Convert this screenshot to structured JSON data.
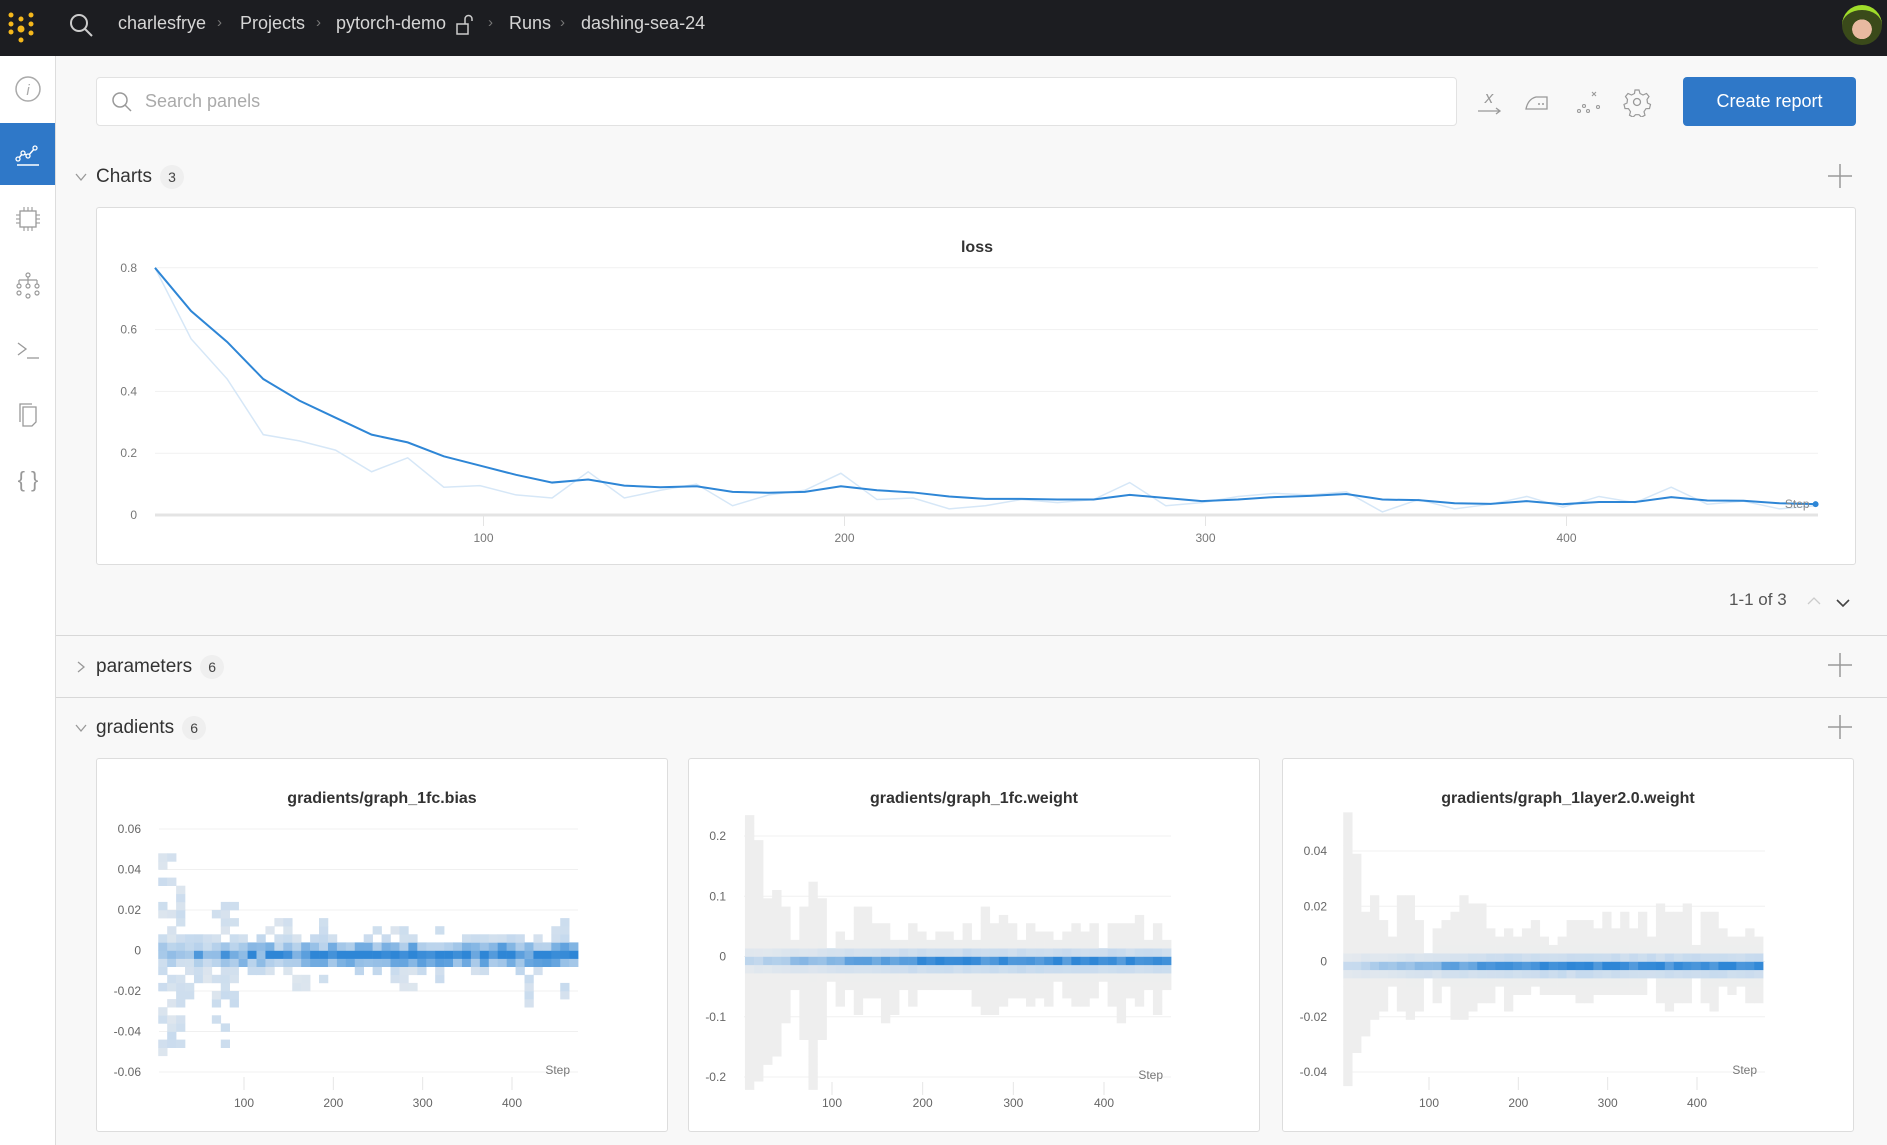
{
  "topbar": {
    "breadcrumbs": [
      "charlesfrye",
      "Projects",
      "pytorch-demo",
      "Runs",
      "dashing-sea-24"
    ],
    "icons": {
      "logo": "wandb-dots-logo",
      "search": "search-icon",
      "lock": "unlock-icon",
      "avatar": "user-avatar"
    }
  },
  "sidebar": {
    "items": [
      {
        "name": "overview",
        "icon": "info-icon",
        "active": false
      },
      {
        "name": "charts",
        "icon": "line-chart-icon",
        "active": true
      },
      {
        "name": "system",
        "icon": "chip-icon",
        "active": false
      },
      {
        "name": "model",
        "icon": "hierarchy-icon",
        "active": false
      },
      {
        "name": "logs",
        "icon": "terminal-icon",
        "active": false
      },
      {
        "name": "files",
        "icon": "files-icon",
        "active": false
      },
      {
        "name": "artifacts",
        "icon": "braces-icon",
        "active": false
      }
    ]
  },
  "toolbar": {
    "search_placeholder": "Search panels",
    "search_value": "",
    "create_report_label": "Create report",
    "icons": [
      "x-axis-icon",
      "smoothing-iron-icon",
      "outlier-icon",
      "settings-gear-icon"
    ]
  },
  "sections": {
    "charts": {
      "label": "Charts",
      "count": "3",
      "expanded": true,
      "pagination": "1-1 of 3"
    },
    "parameters": {
      "label": "parameters",
      "count": "6",
      "expanded": false
    },
    "gradients": {
      "label": "gradients",
      "count": "6",
      "expanded": true
    }
  },
  "colors": {
    "accent": "#2f78c8",
    "line": "#2e86d6",
    "line_raw": "#d6e7f7",
    "topbar": "#1c1d21"
  },
  "chart_data": [
    {
      "type": "line",
      "title": "loss",
      "xlabel": "Step",
      "xlim": [
        0,
        469
      ],
      "ylim": [
        0,
        0.8
      ],
      "xticks": [
        100,
        200,
        300,
        400
      ],
      "yticks": [
        0,
        0.2,
        0.4,
        0.6,
        0.8
      ],
      "ytick_labels": [
        "0",
        "0.2",
        "0.4",
        "0.6",
        "0.8"
      ],
      "grid": true,
      "x": [
        9,
        19,
        29,
        39,
        49,
        59,
        69,
        79,
        89,
        99,
        109,
        119,
        129,
        139,
        149,
        159,
        169,
        179,
        189,
        199,
        209,
        219,
        229,
        239,
        249,
        259,
        269,
        279,
        289,
        299,
        309,
        319,
        329,
        339,
        349,
        359,
        369,
        379,
        389,
        399,
        409,
        419,
        429,
        439,
        449,
        459,
        469
      ],
      "series": [
        {
          "style": "smoothed",
          "values": [
            0.8,
            0.66,
            0.56,
            0.44,
            0.37,
            0.315,
            0.26,
            0.235,
            0.19,
            0.16,
            0.13,
            0.105,
            0.115,
            0.095,
            0.09,
            0.093,
            0.075,
            0.072,
            0.075,
            0.093,
            0.08,
            0.073,
            0.06,
            0.052,
            0.052,
            0.05,
            0.05,
            0.065,
            0.055,
            0.045,
            0.05,
            0.058,
            0.062,
            0.068,
            0.05,
            0.048,
            0.038,
            0.036,
            0.045,
            0.035,
            0.042,
            0.042,
            0.058,
            0.047,
            0.046,
            0.038,
            0.035
          ]
        },
        {
          "style": "raw",
          "values": [
            0.8,
            0.57,
            0.44,
            0.26,
            0.24,
            0.21,
            0.14,
            0.185,
            0.09,
            0.095,
            0.065,
            0.055,
            0.14,
            0.055,
            0.08,
            0.1,
            0.03,
            0.065,
            0.08,
            0.135,
            0.05,
            0.055,
            0.02,
            0.03,
            0.05,
            0.04,
            0.05,
            0.105,
            0.03,
            0.04,
            0.06,
            0.07,
            0.065,
            0.075,
            0.01,
            0.05,
            0.02,
            0.035,
            0.06,
            0.025,
            0.06,
            0.04,
            0.09,
            0.035,
            0.045,
            0.02,
            0.03
          ]
        }
      ]
    },
    {
      "type": "heatmap",
      "title": "gradients/graph_1fc.bias",
      "xlabel": "Step",
      "xticks": [
        100,
        200,
        300,
        400
      ],
      "yticks": [
        0.06,
        0.04,
        0.02,
        0,
        -0.02,
        -0.04,
        -0.06
      ],
      "ytick_labels": [
        "0.06",
        "0.04",
        "0.02",
        "0",
        "-0.02",
        "-0.04",
        "-0.06"
      ],
      "x_start": 9,
      "x_step": 10,
      "bin": 0.004,
      "sparse": true,
      "ranges": [
        [
          0.063,
          -0.053
        ],
        [
          0.047,
          -0.048
        ],
        [
          0.03,
          -0.045
        ],
        [
          0.015,
          -0.03
        ],
        [
          0.01,
          -0.017
        ],
        [
          0.005,
          -0.015
        ],
        [
          0.02,
          -0.037
        ],
        [
          0.027,
          -0.065
        ],
        [
          0.023,
          -0.028
        ],
        [
          0.005,
          -0.005
        ],
        [
          0.008,
          -0.015
        ],
        [
          0.005,
          -0.01
        ],
        [
          0.02,
          -0.02
        ],
        [
          0.015,
          -0.012
        ],
        [
          0.015,
          -0.015
        ],
        [
          0.01,
          -0.028
        ],
        [
          0.007,
          -0.02
        ],
        [
          0.005,
          -0.012
        ],
        [
          0.015,
          -0.015
        ],
        [
          0.007,
          -0.005
        ],
        [
          0.005,
          -0.008
        ],
        [
          0.008,
          -0.008
        ],
        [
          0.01,
          -0.012
        ],
        [
          0.005,
          -0.008
        ],
        [
          0.01,
          -0.012
        ],
        [
          0.005,
          -0.005
        ],
        [
          0.01,
          -0.02
        ],
        [
          0.01,
          -0.02
        ],
        [
          0.008,
          -0.018
        ],
        [
          0.005,
          -0.01
        ],
        [
          0.008,
          -0.012
        ],
        [
          0.01,
          -0.015
        ],
        [
          0.005,
          -0.008
        ],
        [
          0.008,
          -0.012
        ],
        [
          0.005,
          -0.008
        ],
        [
          0.008,
          -0.012
        ],
        [
          0.008,
          -0.012
        ],
        [
          0.005,
          -0.01
        ],
        [
          0.01,
          -0.008
        ],
        [
          0.005,
          -0.005
        ],
        [
          0.008,
          -0.012
        ],
        [
          0.008,
          -0.028
        ],
        [
          0.008,
          -0.012
        ],
        [
          0.005,
          -0.008
        ],
        [
          0.01,
          -0.008
        ],
        [
          0.015,
          -0.023
        ],
        [
          0.008,
          -0.008
        ]
      ]
    },
    {
      "type": "heatmap",
      "title": "gradients/graph_1fc.weight",
      "xlabel": "Step",
      "xticks": [
        100,
        200,
        300,
        400
      ],
      "yticks": [
        0.2,
        0.1,
        0,
        -0.1,
        -0.2
      ],
      "ytick_labels": [
        "0.2",
        "0.1",
        "0",
        "-0.1",
        "-0.2"
      ],
      "x_start": 9,
      "x_step": 10,
      "bin": 0.0138,
      "sparse": false,
      "ranges": [
        [
          0.23,
          -0.21
        ],
        [
          0.19,
          -0.2
        ],
        [
          0.09,
          -0.17
        ],
        [
          0.105,
          -0.155
        ],
        [
          0.08,
          -0.1
        ],
        [
          0.023,
          -0.046
        ],
        [
          0.08,
          -0.13
        ],
        [
          0.12,
          -0.21
        ],
        [
          0.09,
          -0.13
        ],
        [
          0.01,
          -0.032
        ],
        [
          0.037,
          -0.074
        ],
        [
          0.023,
          -0.046
        ],
        [
          0.08,
          -0.087
        ],
        [
          0.08,
          -0.06
        ],
        [
          0.05,
          -0.06
        ],
        [
          0.05,
          -0.1
        ],
        [
          0.023,
          -0.087
        ],
        [
          0.023,
          -0.046
        ],
        [
          0.05,
          -0.074
        ],
        [
          0.037,
          -0.046
        ],
        [
          0.023,
          -0.046
        ],
        [
          0.037,
          -0.046
        ],
        [
          0.037,
          -0.046
        ],
        [
          0.023,
          -0.046
        ],
        [
          0.05,
          -0.046
        ],
        [
          0.023,
          -0.074
        ],
        [
          0.08,
          -0.087
        ],
        [
          0.05,
          -0.087
        ],
        [
          0.065,
          -0.074
        ],
        [
          0.05,
          -0.06
        ],
        [
          0.023,
          -0.06
        ],
        [
          0.05,
          -0.074
        ],
        [
          0.037,
          -0.06
        ],
        [
          0.037,
          -0.074
        ],
        [
          0.023,
          -0.032
        ],
        [
          0.037,
          -0.06
        ],
        [
          0.05,
          -0.074
        ],
        [
          0.037,
          -0.074
        ],
        [
          0.05,
          -0.06
        ],
        [
          0.01,
          -0.032
        ],
        [
          0.05,
          -0.074
        ],
        [
          0.05,
          -0.1
        ],
        [
          0.05,
          -0.06
        ],
        [
          0.065,
          -0.074
        ],
        [
          0.023,
          -0.046
        ],
        [
          0.05,
          -0.087
        ],
        [
          0.023,
          -0.046
        ]
      ]
    },
    {
      "type": "heatmap",
      "title": "gradients/graph_1layer2.0.weight",
      "xlabel": "Step",
      "xticks": [
        100,
        200,
        300,
        400
      ],
      "yticks": [
        0.04,
        0.02,
        0,
        -0.02,
        -0.04
      ],
      "ytick_labels": [
        "0.04",
        "0.02",
        "0",
        "-0.02",
        "-0.04"
      ],
      "x_start": 9,
      "x_step": 10,
      "bin": 0.003,
      "sparse": false,
      "ranges": [
        [
          0.052,
          -0.044
        ],
        [
          0.037,
          -0.032
        ],
        [
          0.016,
          -0.026
        ],
        [
          0.022,
          -0.02
        ],
        [
          0.013,
          -0.017
        ],
        [
          0.007,
          -0.008
        ],
        [
          0.022,
          -0.017
        ],
        [
          0.022,
          -0.02
        ],
        [
          0.013,
          -0.017
        ],
        [
          0.001,
          -0.005
        ],
        [
          0.01,
          -0.014
        ],
        [
          0.013,
          -0.008
        ],
        [
          0.016,
          -0.02
        ],
        [
          0.022,
          -0.02
        ],
        [
          0.019,
          -0.017
        ],
        [
          0.019,
          -0.014
        ],
        [
          0.01,
          -0.014
        ],
        [
          0.007,
          -0.008
        ],
        [
          0.01,
          -0.017
        ],
        [
          0.007,
          -0.011
        ],
        [
          0.01,
          -0.011
        ],
        [
          0.013,
          -0.008
        ],
        [
          0.007,
          -0.011
        ],
        [
          0.004,
          -0.011
        ],
        [
          0.007,
          -0.011
        ],
        [
          0.013,
          -0.011
        ],
        [
          0.013,
          -0.014
        ],
        [
          0.013,
          -0.014
        ],
        [
          0.01,
          -0.011
        ],
        [
          0.016,
          -0.011
        ],
        [
          0.01,
          -0.011
        ],
        [
          0.016,
          -0.011
        ],
        [
          0.01,
          -0.011
        ],
        [
          0.016,
          -0.011
        ],
        [
          0.007,
          -0.005
        ],
        [
          0.019,
          -0.014
        ],
        [
          0.016,
          -0.017
        ],
        [
          0.016,
          -0.014
        ],
        [
          0.019,
          -0.014
        ],
        [
          0.004,
          -0.005
        ],
        [
          0.016,
          -0.014
        ],
        [
          0.016,
          -0.017
        ],
        [
          0.01,
          -0.008
        ],
        [
          0.007,
          -0.011
        ],
        [
          0.007,
          -0.008
        ],
        [
          0.01,
          -0.014
        ],
        [
          0.007,
          -0.014
        ]
      ]
    }
  ]
}
